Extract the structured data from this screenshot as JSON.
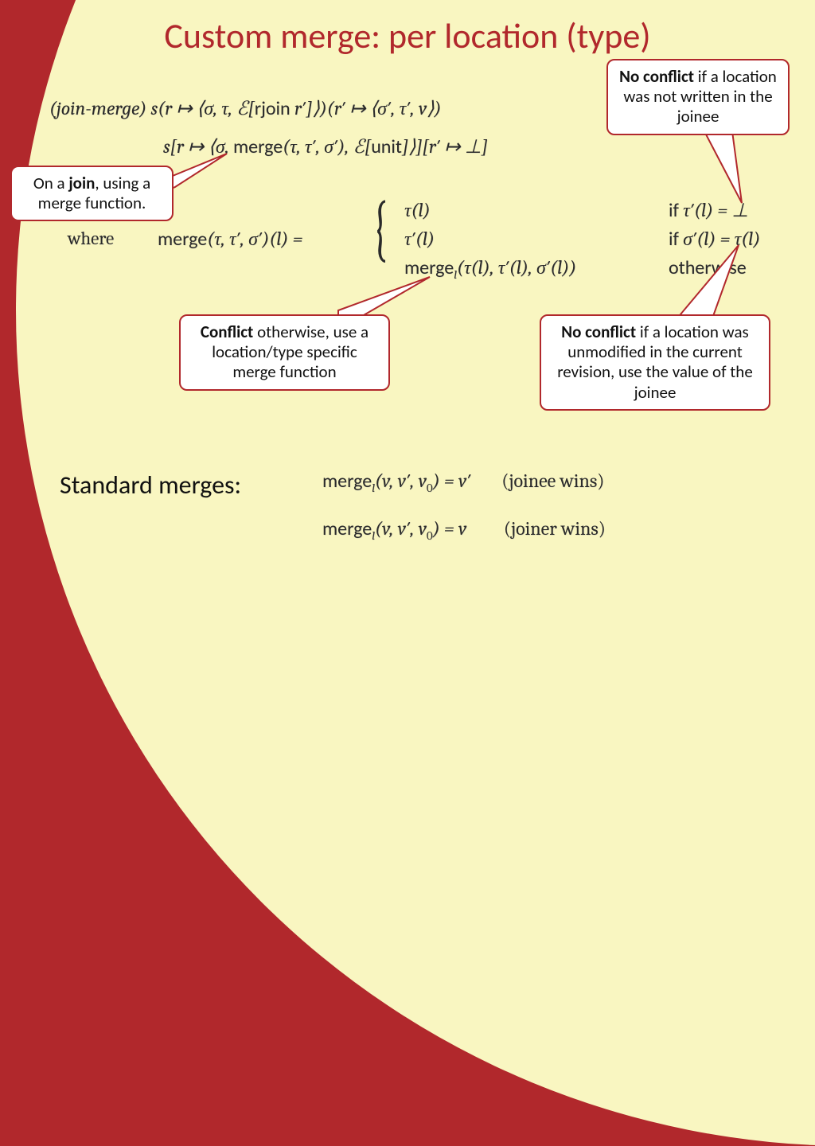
{
  "title": "Custom merge: per location (type)",
  "formula1_a": "(join-merge)",
  "formula1_b": "  s(r ↦ ⟨σ, τ, ℰ[",
  "formula1_c": "rjoin",
  "formula1_d": " r′]⟩)(r′ ↦ ⟨σ′, τ′, v⟩)",
  "formula2_a": "s[r ↦ ⟨σ, ",
  "formula2_b": "merge",
  "formula2_c": "(τ, τ′, σ′), ℰ[",
  "formula2_d": "unit",
  "formula2_e": "]⟩][r′ ↦ ⊥]",
  "where": "where",
  "merge_head_a": "merge",
  "merge_head_b": "(τ, τ′, σ′)(l)  =",
  "case1": "τ(l)",
  "case2": "τ′(l)",
  "case3_a": "merge",
  "case3_b": "(τ(l), τ′(l), σ′(l))",
  "case3_sub": "l",
  "cond1_if": "if",
  "cond1": " τ′(l) = ⊥",
  "cond2_if": "if",
  "cond2": " σ′(l) = τ(l)",
  "cond3": "otherwise",
  "callout_join_a": "On a ",
  "callout_join_b": "join",
  "callout_join_c": ", using a merge function.",
  "callout_noconflict1_a": "No conflict",
  "callout_noconflict1_b": " if a location was not written in the joinee",
  "callout_noconflict2_a": "No conflict",
  "callout_noconflict2_b": " if a location was unmodified in the current revision, use the value of the joinee",
  "callout_conflict_a": "Conflict",
  "callout_conflict_b": " otherwise, use a location/type specific merge function",
  "subheading": "Standard merges:",
  "std1_a": "merge",
  "std1_sub": "l",
  "std1_b": "(v, v′, v",
  "std1_c": ") = v′",
  "std1_zero": "0",
  "std1_d": "(joinee wins)",
  "std2_a": "merge",
  "std2_sub": "l",
  "std2_b": "(v, v′, v",
  "std2_c": ") = v",
  "std2_zero": "0",
  "std2_d": "(joiner wins)"
}
